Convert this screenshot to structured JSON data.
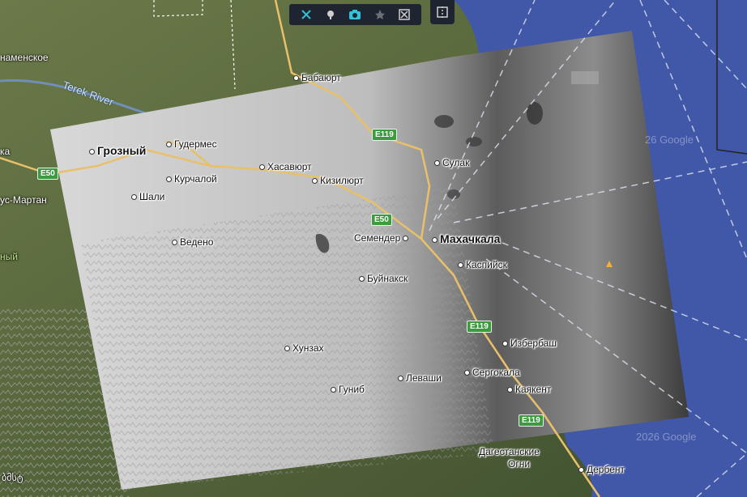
{
  "map": {
    "places": [
      {
        "name": "Грозный",
        "big": true
      },
      {
        "name": "Гудермес"
      },
      {
        "name": "Хасавюрт"
      },
      {
        "name": "Курчалой"
      },
      {
        "name": "Кизилюрт"
      },
      {
        "name": "Шали"
      },
      {
        "name": "Ведено"
      },
      {
        "name": "Бабаюрт"
      },
      {
        "name": "Сулак"
      },
      {
        "name": "Семендер"
      },
      {
        "name": "Махачкала",
        "big": true
      },
      {
        "name": "Каспийск"
      },
      {
        "name": "Буйнакск"
      },
      {
        "name": "Хунзах"
      },
      {
        "name": "Избербаш"
      },
      {
        "name": "Сергокала"
      },
      {
        "name": "Леваши"
      },
      {
        "name": "Гуниб"
      },
      {
        "name": "Каякент"
      },
      {
        "name": "Дагестанские"
      },
      {
        "name": "Огни"
      },
      {
        "name": "Дербент"
      }
    ],
    "edge_labels": {
      "top_left": "наменское",
      "left_ka": "ка",
      "left_martan": "ус-Мартан",
      "left_ny": "ный",
      "bottom_left": "ბმსტ"
    },
    "river": "Terek River",
    "roads": [
      "E119",
      "E50",
      "E50",
      "E119",
      "E119"
    ],
    "watermarks": [
      "26 Google",
      "2026 Google"
    ],
    "colors": {
      "sea": "#4157a8",
      "land": "#5a6b3e",
      "sar_overlay": "#c9c9c9",
      "road": "#e8c06a",
      "toolbar": "#1f2530",
      "accent": "#35c2d8"
    }
  },
  "toolbar": {
    "buttons": [
      {
        "icon": "tools-icon"
      },
      {
        "icon": "pin-icon"
      },
      {
        "icon": "camera-icon"
      },
      {
        "icon": "star-icon"
      },
      {
        "icon": "scissors-icon"
      }
    ],
    "side_button_icon": "split-view-icon"
  }
}
